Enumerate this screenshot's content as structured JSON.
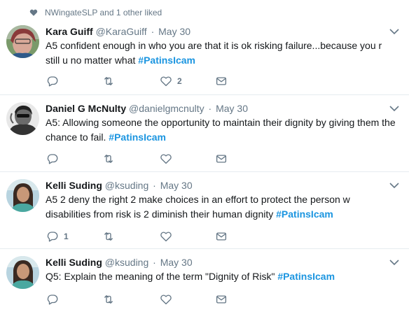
{
  "liked_by": "NWingateSLP and 1 other liked",
  "colors": {
    "accent": "#1b95e0",
    "muted": "#657786",
    "border": "#e6ecf0"
  },
  "tweets": [
    {
      "name": "Kara Guiff",
      "handle": "@KaraGuiff",
      "separator": "·",
      "time": "May 30",
      "text": "A5 confident enough in who you are that it is ok risking failure...because you r still u no matter what ",
      "hashtag": "#PatinsIcam",
      "reply_count": "",
      "retweet_count": "",
      "like_count": "2"
    },
    {
      "name": "Daniel G McNulty",
      "handle": "@danielgmcnulty",
      "separator": "·",
      "time": "May 30",
      "text": "A5: Allowing someone the opportunity to maintain their dignity by giving them the chance to fail. ",
      "hashtag": "#PatinsIcam",
      "reply_count": "",
      "retweet_count": "",
      "like_count": ""
    },
    {
      "name": "Kelli Suding",
      "handle": "@ksuding",
      "separator": "·",
      "time": "May 30",
      "text": "A5 2 deny the right 2 make choices in an effort to protect the person w disabilities from risk is 2 diminish their human dignity ",
      "hashtag": "#PatinsIcam",
      "reply_count": "1",
      "retweet_count": "",
      "like_count": ""
    },
    {
      "name": "Kelli Suding",
      "handle": "@ksuding",
      "separator": "·",
      "time": "May 30",
      "text": "Q5: Explain the meaning of the term \"Dignity of Risk\" ",
      "hashtag": "#PatinsIcam",
      "reply_count": "",
      "retweet_count": "",
      "like_count": ""
    }
  ]
}
